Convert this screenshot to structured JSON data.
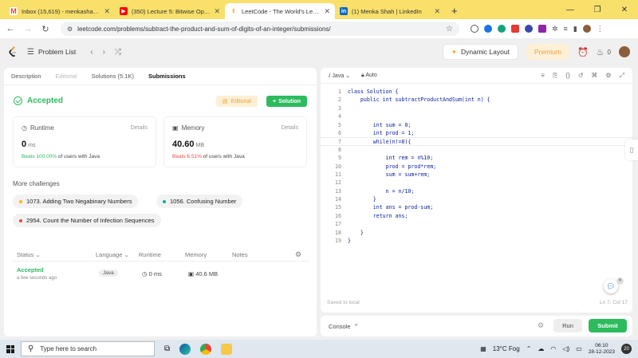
{
  "browser": {
    "tabs": [
      {
        "label": "Inbox (15,619) - menkashah06@",
        "favicon": "gmail-icon",
        "color": "#ea4335",
        "active": false
      },
      {
        "label": "(350) Lecture 5: Bitwise Operat",
        "favicon": "youtube-icon",
        "color": "#ff0000",
        "active": false
      },
      {
        "label": "LeetCode - The World's Leading",
        "favicon": "leetcode-icon",
        "color": "#f89f1b",
        "active": true
      },
      {
        "label": "(1) Menka Shah | LinkedIn",
        "favicon": "linkedin-icon",
        "color": "#0a66c2",
        "active": false
      }
    ],
    "url": "leetcode.com/problems/subtract-the-product-and-sum-of-digits-of-an-integer/submissions/"
  },
  "header": {
    "problem_list": "Problem List",
    "dynamic_layout": "Dynamic Layout",
    "premium": "Premium",
    "counter": "0"
  },
  "left": {
    "tabs": [
      "Description",
      "Editorial",
      "Solutions (5.1K)",
      "Submissions"
    ],
    "status": "Accepted",
    "editorial_btn": "Editorial",
    "solution_btn": "Solution",
    "runtime": {
      "title": "Runtime",
      "details": "Details",
      "value": "0",
      "unit": "ms",
      "beats_pct": "Beats 100.00%",
      "beats_text": "of users with Java"
    },
    "memory": {
      "title": "Memory",
      "details": "Details",
      "value": "40.60",
      "unit": "MB",
      "beats_pct": "Beats 6.51%",
      "beats_text": "of users with Java"
    },
    "more_title": "More challenges",
    "challenges": [
      {
        "label": "1073. Adding Two Negabinary Numbers",
        "color": "#ffb800"
      },
      {
        "label": "1056. Confusing Number",
        "color": "#00af9b"
      },
      {
        "label": "2954. Count the Number of Infection Sequences",
        "color": "#ef4743"
      }
    ],
    "table_headers": [
      "Status",
      "Language",
      "Runtime",
      "Memory",
      "Notes"
    ],
    "rows": [
      {
        "status": "Accepted",
        "time": "a few seconds ago",
        "language": "Java",
        "runtime": "0 ms",
        "memory": "40.6 MB"
      }
    ]
  },
  "editor": {
    "language": "Java",
    "mode": "Auto",
    "code": [
      "class Solution {",
      "    public int subtractProductAndSum(int n) {",
      "",
      "",
      "        int sum = 0;",
      "        int prod = 1;",
      "        while(n!=0){",
      "",
      "            int rem = n%10;",
      "            prod = prod*rem;",
      "            sum = sum+rem;",
      "",
      "            n = n/10;",
      "        }",
      "        int ans = prod-sum;",
      "        return ans;",
      "",
      "    }",
      "}"
    ],
    "saved": "Saved to local",
    "cursor": "Ln 7, Col 17"
  },
  "console": {
    "label": "Console",
    "run": "Run",
    "submit": "Submit"
  },
  "taskbar": {
    "search_placeholder": "Type here to search",
    "weather": "13°C Fog",
    "time": "06:10",
    "date": "28-12-2023",
    "notifications": "20"
  }
}
